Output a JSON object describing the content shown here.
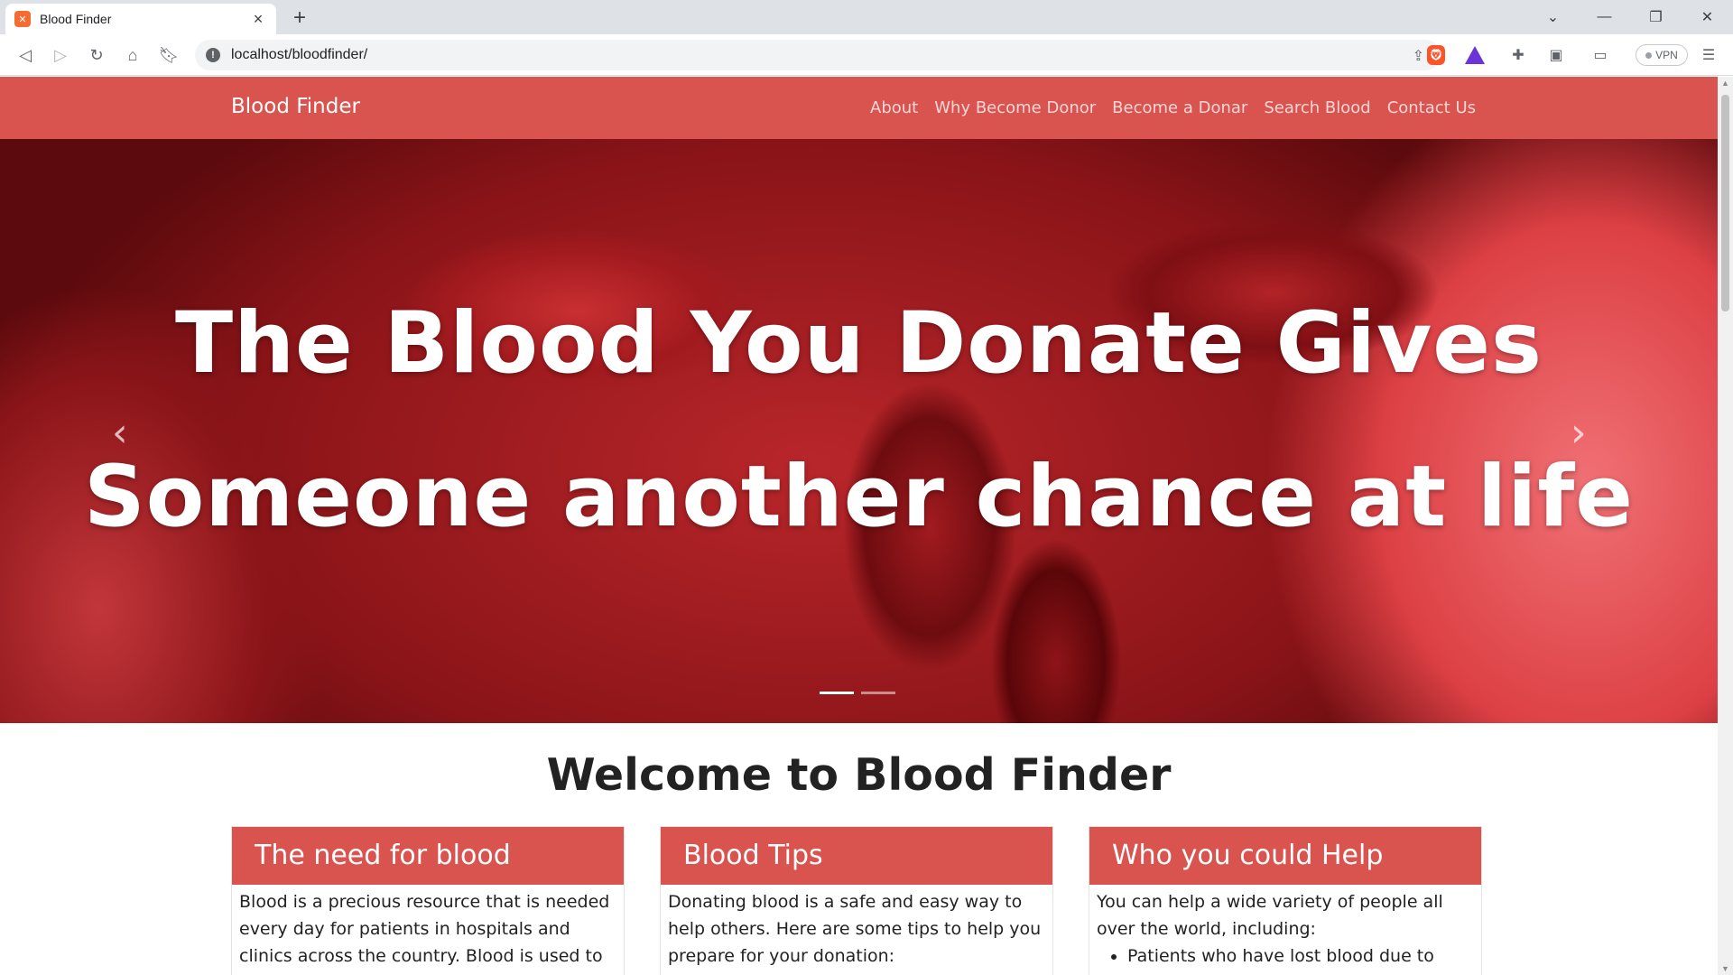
{
  "browser": {
    "tab_title": "Blood Finder",
    "url": "localhost/bloodfinder/",
    "vpn_label": "VPN",
    "icons": [
      "back-icon",
      "forward-icon",
      "reload-icon",
      "home-icon",
      "bookmark-icon",
      "share-icon",
      "brave-shields-icon",
      "brave-rewards-icon",
      "extensions-icon",
      "sidebar-icon",
      "wallet-icon",
      "menu-icon"
    ]
  },
  "site": {
    "brand": "Blood Finder",
    "menu": [
      "About",
      "Why Become Donor",
      "Become a Donar",
      "Search Blood",
      "Contact Us"
    ]
  },
  "hero": {
    "line1": "The Blood You Donate Gives",
    "line2": "Someone another chance at life",
    "slides": 2,
    "active_slide": 1
  },
  "welcome": "Welcome to Blood Finder",
  "cards": [
    {
      "title": "The need for blood",
      "text": "Blood is a precious resource that is needed every day for patients in hospitals and clinics across the country. Blood is used to treat a wide variety"
    },
    {
      "title": "Blood Tips",
      "text": "Donating blood is a safe and easy way to help others. Here are some tips to help you prepare for your donation:"
    },
    {
      "title": "Who you could Help",
      "text": "You can help a wide variety of people all over the world, including:",
      "list": [
        "Patients who have lost blood due to"
      ]
    }
  ],
  "colors": {
    "brand_red": "#d9534f",
    "chrome_gray": "#dee1e6"
  }
}
